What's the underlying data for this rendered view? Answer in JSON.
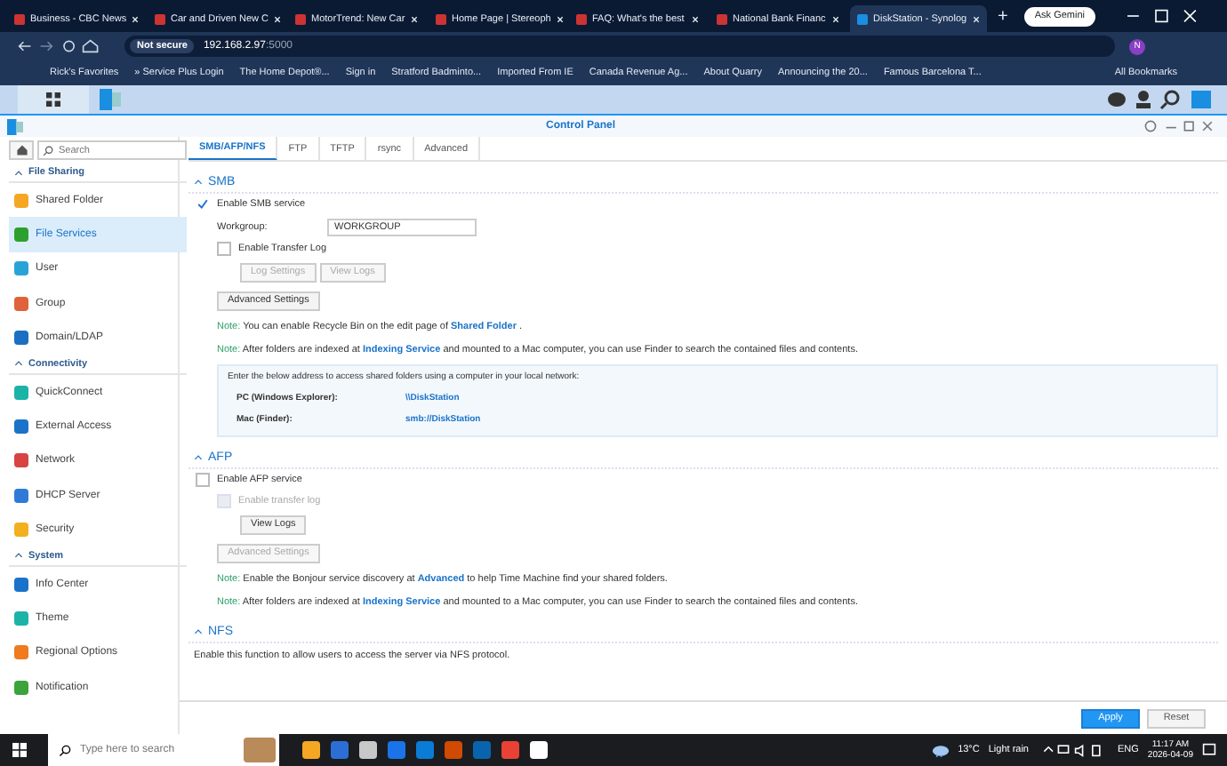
{
  "browser": {
    "tabs": [
      {
        "title": "Business - CBC News",
        "selected": false
      },
      {
        "title": "Car and Driven New C",
        "selected": false
      },
      {
        "title": "MotorTrend: New Car",
        "selected": false
      },
      {
        "title": "Home Page | Stereoph",
        "selected": false
      },
      {
        "title": "FAQ: What's the best",
        "selected": false
      },
      {
        "title": "National Bank Financ",
        "selected": false
      },
      {
        "title": "DiskStation - Synolog",
        "selected": true
      }
    ],
    "new_tab": "+",
    "gemini": "Ask Gemini",
    "security": "Not secure",
    "url_host": "192.168.2.97",
    "url_port": ":5000",
    "profile": "N",
    "bookmarks": [
      "Rick's Favorites",
      "» Service Plus Login",
      "The Home Depot®...",
      "Sign in",
      "Stratford Badminto...",
      "Imported From IE",
      "Canada Revenue Ag...",
      "About Quarry",
      "Announcing the 20...",
      "Famous Barcelona T..."
    ],
    "all_bookmarks": "All Bookmarks"
  },
  "window": {
    "title": "Control Panel"
  },
  "sidebar": {
    "search_placeholder": "Search",
    "groups": [
      {
        "title": "File Sharing",
        "items": [
          {
            "label": "Shared Folder",
            "selected": false
          },
          {
            "label": "File Services",
            "selected": true
          },
          {
            "label": "User",
            "selected": false
          },
          {
            "label": "Group",
            "selected": false
          },
          {
            "label": "Domain/LDAP",
            "selected": false
          }
        ]
      },
      {
        "title": "Connectivity",
        "items": [
          {
            "label": "QuickConnect",
            "selected": false
          },
          {
            "label": "External Access",
            "selected": false
          },
          {
            "label": "Network",
            "selected": false
          },
          {
            "label": "DHCP Server",
            "selected": false
          },
          {
            "label": "Security",
            "selected": false
          }
        ]
      },
      {
        "title": "System",
        "items": [
          {
            "label": "Info Center",
            "selected": false
          },
          {
            "label": "Theme",
            "selected": false
          },
          {
            "label": "Regional Options",
            "selected": false
          },
          {
            "label": "Notification",
            "selected": false
          }
        ]
      }
    ]
  },
  "tabs": [
    {
      "label": "SMB/AFP/NFS",
      "selected": true
    },
    {
      "label": "FTP",
      "selected": false
    },
    {
      "label": "TFTP",
      "selected": false
    },
    {
      "label": "rsync",
      "selected": false
    },
    {
      "label": "Advanced",
      "selected": false
    }
  ],
  "smb": {
    "title": "SMB",
    "enable": {
      "label": "Enable SMB service",
      "checked": true
    },
    "workgroup_label": "Workgroup:",
    "workgroup": "WORKGROUP",
    "transfer_log": {
      "label": "Enable Transfer Log",
      "checked": false,
      "disabled": false
    },
    "log_buttons": [
      {
        "label": "Log Settings",
        "disabled": true
      },
      {
        "label": "View Logs",
        "disabled": true
      }
    ],
    "advanced": {
      "label": "Advanced Settings",
      "disabled": false
    },
    "notes": [
      {
        "label": "Note:",
        "before": "You can enable Recycle Bin on the edit page of",
        "link": "Shared Folder",
        "after": "."
      },
      {
        "label": "Note:",
        "before": "After folders are indexed at",
        "link": "Indexing Service",
        "after": "and mounted to a Mac computer, you can use Finder to search the contained files and contents."
      }
    ],
    "address_intro": "Enter the below address to access shared folders using a computer in your local network:",
    "addresses": [
      {
        "label": "PC (Windows Explorer):",
        "value": "\\\\DiskStation"
      },
      {
        "label": "Mac (Finder):",
        "value": "smb://DiskStation"
      }
    ]
  },
  "afp": {
    "title": "AFP",
    "enable": {
      "label": "Enable AFP service",
      "checked": false
    },
    "transfer_log": {
      "label": "Enable transfer log",
      "checked": false,
      "disabled": true
    },
    "log_buttons": [
      {
        "label": "View Logs",
        "disabled": false
      }
    ],
    "advanced": {
      "label": "Advanced Settings",
      "disabled": true
    },
    "notes": [
      {
        "label": "Note:",
        "before": "Enable the Bonjour service discovery at",
        "link": "Advanced",
        "after": "to help Time Machine find your shared folders."
      },
      {
        "label": "Note:",
        "before": "After folders are indexed at",
        "link": "Indexing Service",
        "after": "and mounted to a Mac computer, you can use Finder to search the contained files and contents."
      }
    ]
  },
  "nfs": {
    "title": "NFS",
    "description": "Enable this function to allow users to access the server via NFS protocol."
  },
  "footer": {
    "apply": "Apply",
    "reset": "Reset"
  },
  "taskbar": {
    "search_placeholder": "Type here to search",
    "temperature": "13°C",
    "weather": "Light rain",
    "language": "ENG",
    "time": "11:17 AM",
    "date": "2026-04-09"
  }
}
